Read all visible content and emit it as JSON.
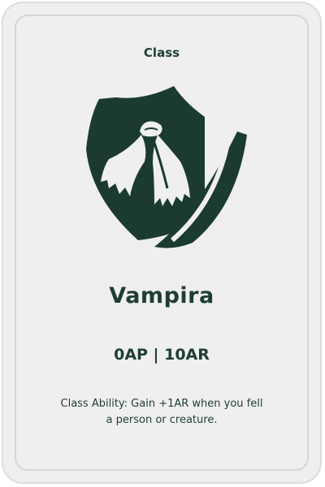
{
  "card": {
    "type_label": "Class",
    "name": "Vampira",
    "stats": "0AP | 10AR",
    "ability": "Class Ability: Gain +1AR when you fell a person or creature."
  },
  "emblem": {
    "icon": "shield-cape-icon",
    "color": "#1b3a32"
  },
  "colors": {
    "card_background": "#efefef",
    "card_border": "#d6d6d6",
    "text": "#1f3d35"
  }
}
